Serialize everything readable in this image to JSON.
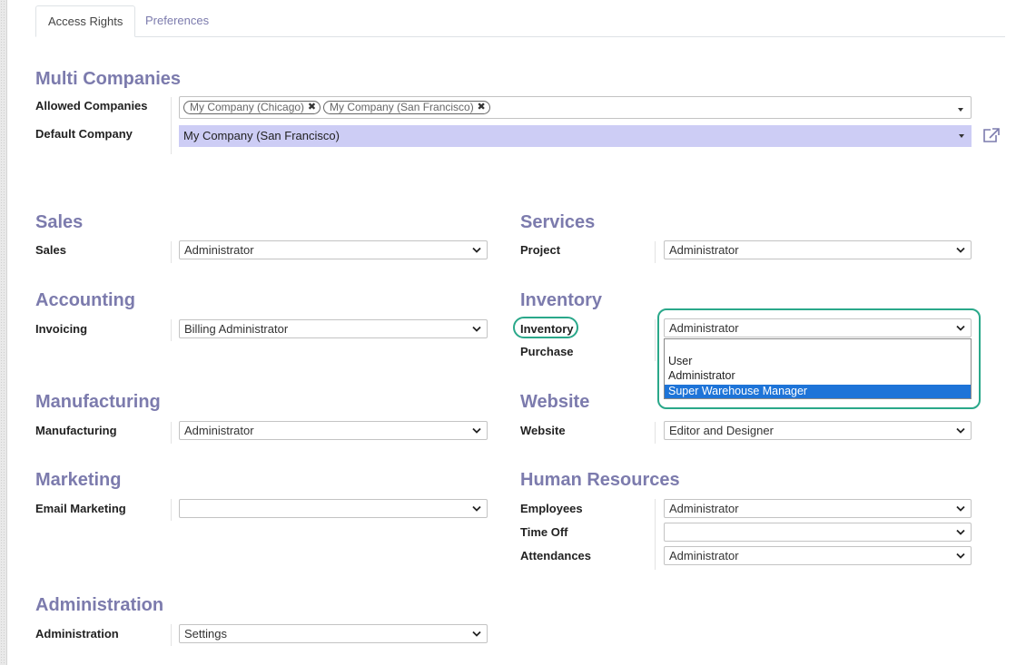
{
  "tabs": [
    {
      "label": "Access Rights",
      "active": true
    },
    {
      "label": "Preferences",
      "active": false
    }
  ],
  "multi_companies": {
    "title": "Multi Companies",
    "allowed_companies_label": "Allowed Companies",
    "allowed_companies": [
      "My Company (Chicago)",
      "My Company (San Francisco)"
    ],
    "default_company_label": "Default Company",
    "default_company_value": "My Company (San Francisco)"
  },
  "groups": {
    "sales": {
      "title": "Sales",
      "fields": [
        {
          "label": "Sales",
          "value": "Administrator"
        }
      ]
    },
    "services": {
      "title": "Services",
      "fields": [
        {
          "label": "Project",
          "value": "Administrator"
        }
      ]
    },
    "accounting": {
      "title": "Accounting",
      "fields": [
        {
          "label": "Invoicing",
          "value": "Billing Administrator"
        }
      ]
    },
    "inventory": {
      "title": "Inventory",
      "fields": [
        {
          "label": "Inventory",
          "value": "Administrator"
        },
        {
          "label": "Purchase",
          "value": ""
        }
      ],
      "dropdown_options": [
        "",
        "User",
        "Administrator",
        "Super Warehouse Manager"
      ],
      "highlighted_option": "Super Warehouse Manager"
    },
    "manufacturing": {
      "title": "Manufacturing",
      "fields": [
        {
          "label": "Manufacturing",
          "value": "Administrator"
        }
      ]
    },
    "website": {
      "title": "Website",
      "fields": [
        {
          "label": "Website",
          "value": "Editor and Designer"
        }
      ]
    },
    "marketing": {
      "title": "Marketing",
      "fields": [
        {
          "label": "Email Marketing",
          "value": ""
        }
      ]
    },
    "human_resources": {
      "title": "Human Resources",
      "fields": [
        {
          "label": "Employees",
          "value": "Administrator"
        },
        {
          "label": "Time Off",
          "value": ""
        },
        {
          "label": "Attendances",
          "value": "Administrator"
        }
      ]
    },
    "administration": {
      "title": "Administration",
      "fields": [
        {
          "label": "Administration",
          "value": "Settings"
        }
      ]
    }
  },
  "colors": {
    "group_title": "#7c7bad",
    "default_company_bg": "#cdcdf5",
    "highlight_outline": "#2aa88a",
    "selected_option_bg": "#1e74d8"
  },
  "icons": {
    "tag_remove": "times-icon",
    "external_link": "external-link-icon",
    "select_arrow": "chevron-down-icon"
  }
}
